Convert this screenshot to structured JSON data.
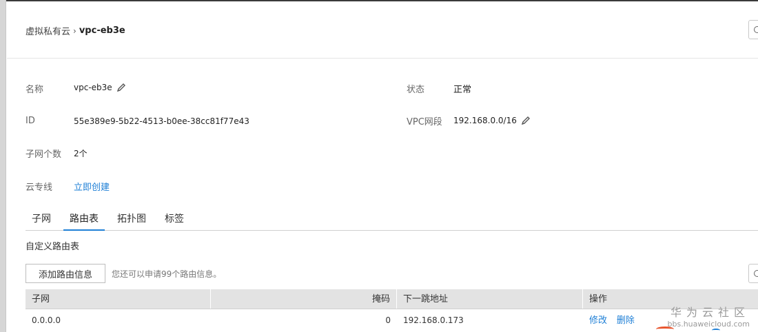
{
  "breadcrumb": {
    "parent": "虚拟私有云",
    "separator": "›",
    "current": "vpc-eb3e"
  },
  "details": {
    "name_label": "名称",
    "name_value": "vpc-eb3e",
    "id_label": "ID",
    "id_value": "55e389e9-5b22-4513-b0ee-38cc81f77e43",
    "subnet_count_label": "子网个数",
    "subnet_count_value": "2个",
    "direct_connect_label": "云专线",
    "direct_connect_link": "立即创建",
    "status_label": "状态",
    "status_value": "正常",
    "cidr_label": "VPC网段",
    "cidr_value": "192.168.0.0/16"
  },
  "tabs": [
    {
      "label": "子网",
      "active": false
    },
    {
      "label": "路由表",
      "active": true
    },
    {
      "label": "拓扑图",
      "active": false
    },
    {
      "label": "标签",
      "active": false
    }
  ],
  "route_section": {
    "title": "自定义路由表",
    "add_button": "添加路由信息",
    "hint": "您还可以申请99个路由信息。"
  },
  "table": {
    "headers": [
      "子网",
      "掩码",
      "下一跳地址",
      "操作"
    ],
    "rows": [
      {
        "subnet": "0.0.0.0",
        "mask": "0",
        "next_hop": "192.168.0.173",
        "edit": "修改",
        "delete": "删除"
      }
    ]
  },
  "watermark": {
    "title": "华为云社区",
    "url": "bbs.huaweicloud.com"
  },
  "colors": {
    "accent": "#1e7fd6",
    "header_bg": "#e3e3e3"
  }
}
